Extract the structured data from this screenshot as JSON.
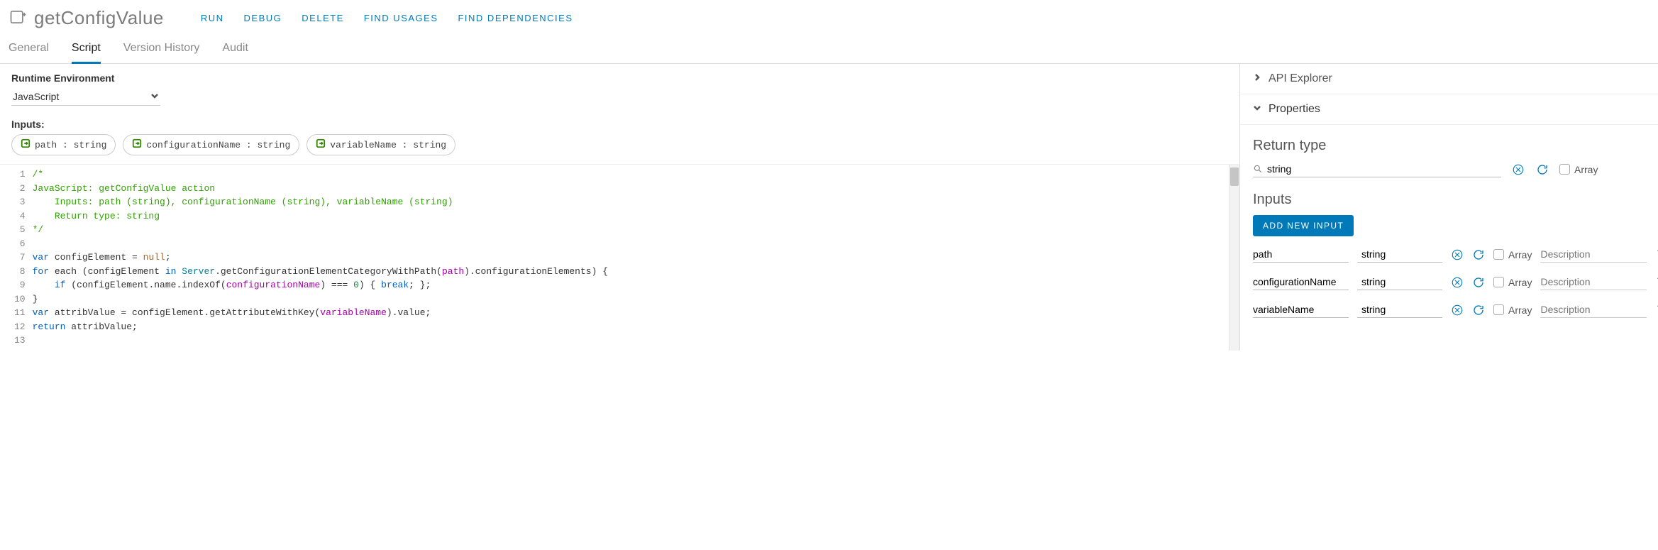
{
  "header": {
    "title": "getConfigValue",
    "actions": [
      "RUN",
      "DEBUG",
      "DELETE",
      "FIND USAGES",
      "FIND DEPENDENCIES"
    ]
  },
  "tabs": [
    "General",
    "Script",
    "Version History",
    "Audit"
  ],
  "active_tab": "Script",
  "left": {
    "runtime_label": "Runtime Environment",
    "runtime_value": "JavaScript",
    "inputs_label": "Inputs:",
    "chips": [
      {
        "name": "path",
        "type": "string"
      },
      {
        "name": "configurationName",
        "type": "string"
      },
      {
        "name": "variableName",
        "type": "string"
      }
    ]
  },
  "code": {
    "lines": [
      {
        "n": 1,
        "html": "<span class='c-cm'>/*</span>"
      },
      {
        "n": 2,
        "html": "<span class='c-cm'>JavaScript: getConfigValue action</span>"
      },
      {
        "n": 3,
        "html": "<span class='c-cm'>    Inputs: path (string), configurationName (string), variableName (string)</span>"
      },
      {
        "n": 4,
        "html": "<span class='c-cm'>    Return type: string</span>"
      },
      {
        "n": 5,
        "html": "<span class='c-cm'>*/</span>"
      },
      {
        "n": 6,
        "html": ""
      },
      {
        "n": 7,
        "html": "<span class='c-kw'>var</span> configElement = <span class='c-nl'>null</span>;"
      },
      {
        "n": 8,
        "html": "<span class='c-kw'>for</span> each (configElement <span class='c-kw'>in</span> <span class='c-ty'>Server</span>.getConfigurationElementCategoryWithPath(<span class='c-id'>path</span>).configurationElements) {"
      },
      {
        "n": 9,
        "html": "    <span class='c-kw'>if</span> (configElement.name.indexOf(<span class='c-id'>configurationName</span>) === <span class='c-num'>0</span>) { <span class='c-kw'>break</span>; };"
      },
      {
        "n": 10,
        "html": "}"
      },
      {
        "n": 11,
        "html": "<span class='c-kw'>var</span> attribValue = configElement.getAttributeWithKey(<span class='c-id'>variableName</span>).value;"
      },
      {
        "n": 12,
        "html": "<span class='c-kw'>return</span> attribValue;"
      },
      {
        "n": 13,
        "html": ""
      }
    ]
  },
  "right": {
    "api_explorer": "API Explorer",
    "properties": "Properties",
    "return_label": "Return type",
    "return_type": "string",
    "array_label": "Array",
    "inputs_label": "Inputs",
    "add_button": "ADD NEW INPUT",
    "desc_placeholder": "Description",
    "rows": [
      {
        "name": "path",
        "type": "string"
      },
      {
        "name": "configurationName",
        "type": "string"
      },
      {
        "name": "variableName",
        "type": "string"
      }
    ]
  }
}
